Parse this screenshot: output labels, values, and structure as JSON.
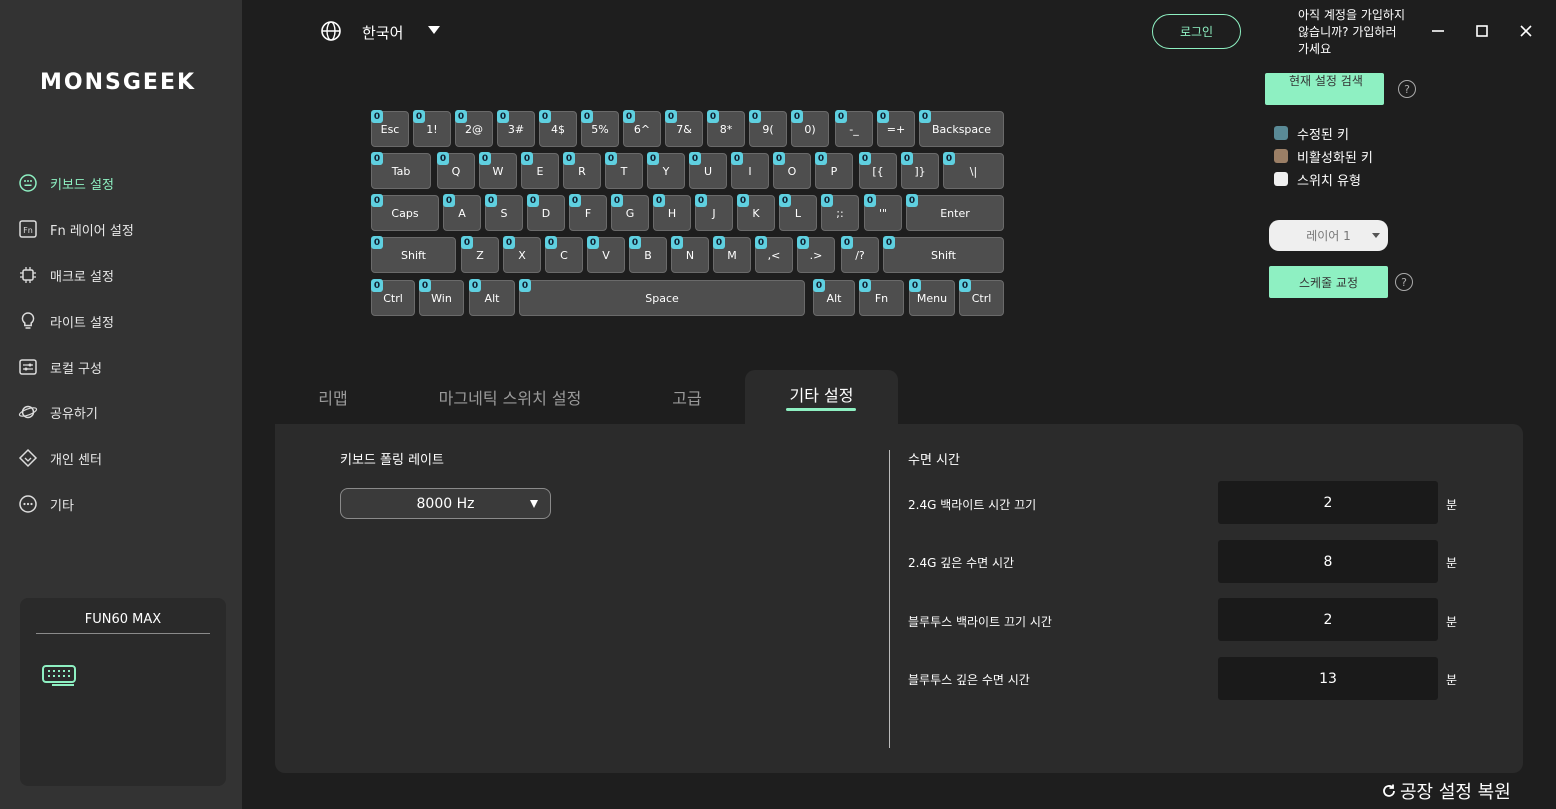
{
  "app": {
    "logo_text": "MONSGEEK"
  },
  "sidebar": {
    "items": [
      {
        "label": "키보드 설정",
        "icon": "keyboard-circle-icon",
        "active": true
      },
      {
        "label": "Fn 레이어 설정",
        "icon": "fn-icon"
      },
      {
        "label": "매크로 설정",
        "icon": "chip-icon"
      },
      {
        "label": "라이트 설정",
        "icon": "bulb-icon"
      },
      {
        "label": "로컬 구성",
        "icon": "sliders-icon"
      },
      {
        "label": "공유하기",
        "icon": "planet-icon"
      },
      {
        "label": "개인 센터",
        "icon": "diamond-icon"
      },
      {
        "label": "기타",
        "icon": "more-circle-icon"
      }
    ],
    "device": {
      "name": "FUN60 MAX",
      "icon": "keyboard-icon"
    }
  },
  "header": {
    "language": "한국어",
    "login_label": "로그인",
    "signup_prompt": "아직 계정을 가입하지 않습니까? 가입하러 가세요"
  },
  "right_panel": {
    "search_label": "현재 설정 검색",
    "help_glyph": "?",
    "legend": [
      {
        "label": "수정된 키",
        "color": "#5a8a96"
      },
      {
        "label": "비활성화된 키",
        "color": "#9b7f66"
      },
      {
        "label": "스위치 유형",
        "color": "#f0f0f0"
      }
    ],
    "layer_select": "레이어 1",
    "schedule_label": "스케줄 교정"
  },
  "keyboard": {
    "badge_value": "0",
    "rows": [
      [
        "Esc",
        "1!",
        "2@",
        "3#",
        "4$",
        "5%",
        "6^",
        "7&",
        "8*",
        "9(",
        "0)",
        "-_",
        "=+",
        "Backspace"
      ],
      [
        "Tab",
        "Q",
        "W",
        "E",
        "R",
        "T",
        "Y",
        "U",
        "I",
        "O",
        "P",
        "[{",
        "]}",
        "\\|"
      ],
      [
        "Caps",
        "A",
        "S",
        "D",
        "F",
        "G",
        "H",
        "J",
        "K",
        "L",
        ";:",
        "'\"",
        "Enter"
      ],
      [
        "Shift",
        "Z",
        "X",
        "C",
        "V",
        "B",
        "N",
        "M",
        ",<",
        ".>",
        "/?",
        "Shift"
      ],
      [
        "Ctrl",
        "Win",
        "Alt",
        "Space",
        "Alt",
        "Fn",
        "Menu",
        "Ctrl"
      ]
    ]
  },
  "tabs": [
    {
      "label": "리맵"
    },
    {
      "label": "마그네틱 스위치 설정"
    },
    {
      "label": "고급"
    },
    {
      "label": "기타 설정",
      "active": true
    }
  ],
  "settings": {
    "polling_label": "키보드 폴링 레이트",
    "polling_value": "8000 Hz",
    "sleep_title": "수면 시간",
    "unit": "분",
    "sleep_rows": [
      {
        "label": "2.4G 백라이트 시간 끄기",
        "value": "2"
      },
      {
        "label": "2.4G 깊은 수면 시간",
        "value": "8"
      },
      {
        "label": "블루투스 백라이트 끄기 시간",
        "value": "2"
      },
      {
        "label": "블루투스 깊은 수면 시간",
        "value": "13"
      }
    ]
  },
  "footer": {
    "reset_label": "공장 설정 복원"
  },
  "colors": {
    "accent": "#8ef0c2",
    "badge": "#5fd0e0",
    "sidebar_bg": "#333333"
  }
}
